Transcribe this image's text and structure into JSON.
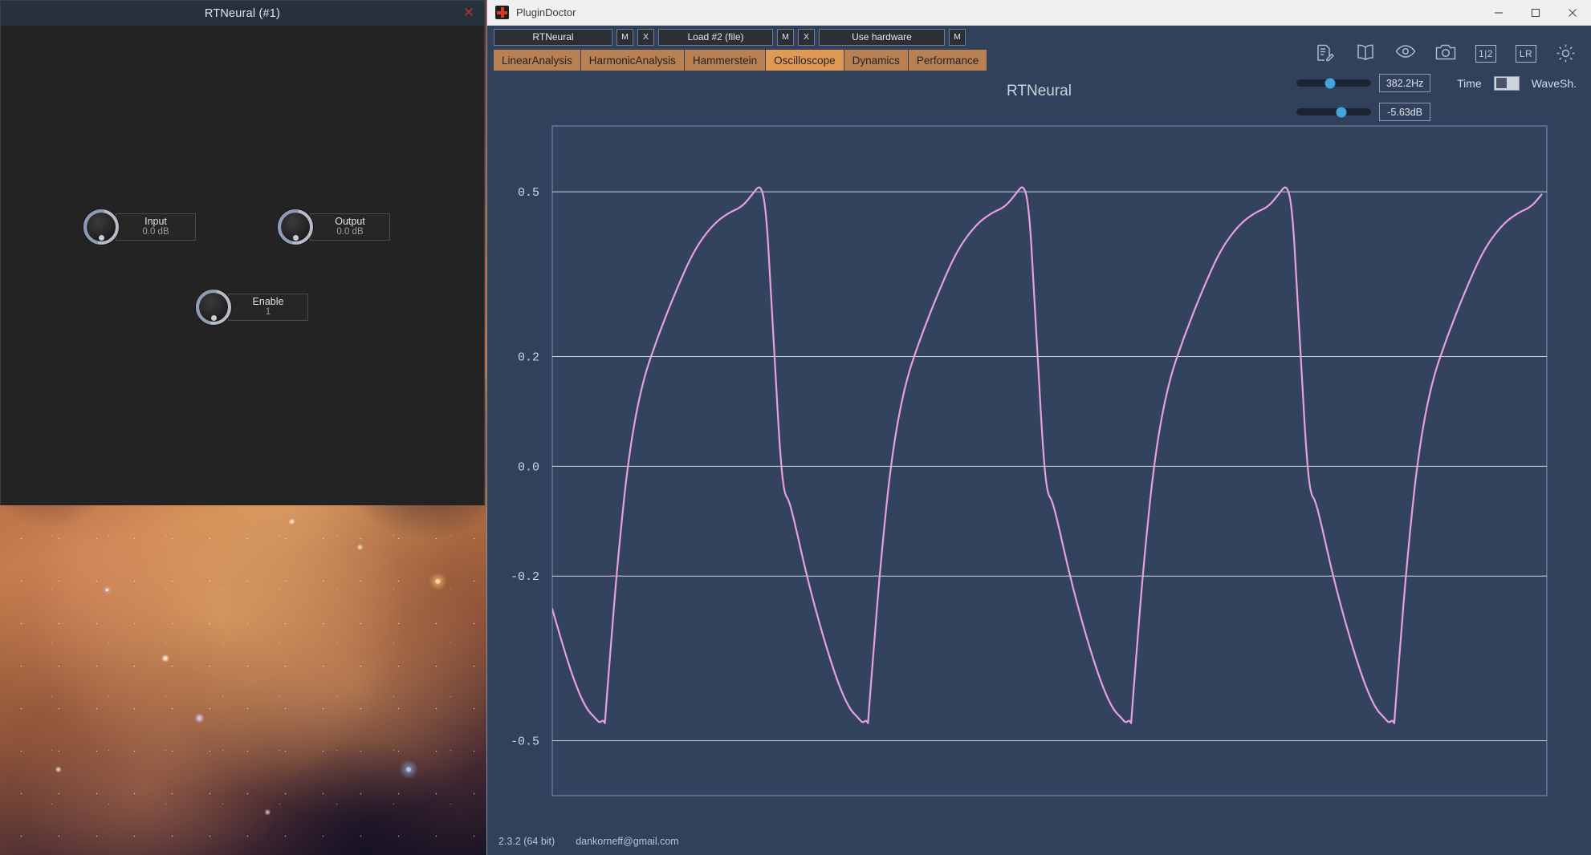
{
  "plugin_window": {
    "title": "RTNeural (#1)",
    "close_icon": "close-icon",
    "knobs": [
      {
        "name": "Input",
        "value": "0.0 dB"
      },
      {
        "name": "Output",
        "value": "0.0 dB"
      },
      {
        "name": "Enable",
        "value": "1"
      }
    ]
  },
  "pd_window": {
    "title": "PluginDoctor",
    "app_icon": "plugindoctor-cross-icon",
    "window_buttons": {
      "minimize": "—",
      "maximize": "☐",
      "close": "✕"
    },
    "slots": [
      {
        "label": "RTNeural",
        "mute": "M",
        "remove": "X"
      },
      {
        "label": "Load #2 (file)",
        "mute": "M",
        "remove": "X"
      },
      {
        "label": "Use hardware",
        "mute": "M",
        "remove": null
      }
    ],
    "tabs": [
      {
        "label": "LinearAnalysis",
        "active": false
      },
      {
        "label": "HarmonicAnalysis",
        "active": false
      },
      {
        "label": "Hammerstein",
        "active": false
      },
      {
        "label": "Oscilloscope",
        "active": true
      },
      {
        "label": "Dynamics",
        "active": false
      },
      {
        "label": "Performance",
        "active": false
      }
    ],
    "toolbar_icons": [
      {
        "name": "notes-edit-icon",
        "label": ""
      },
      {
        "name": "manual-book-icon",
        "label": ""
      },
      {
        "name": "eye-icon",
        "label": ""
      },
      {
        "name": "camera-icon",
        "label": ""
      },
      {
        "name": "ab-compare-icon",
        "label": "1|2"
      },
      {
        "name": "left-right-channel-icon",
        "label": "LR"
      },
      {
        "name": "gear-icon",
        "label": ""
      }
    ],
    "controls": {
      "frequency_value": "382.2Hz",
      "level_value": "-5.63dB",
      "freq_slider_pct": 45,
      "level_slider_pct": 60,
      "mode_left_label": "Time",
      "mode_right_label": "WaveSh.",
      "mode_toggle_state": "left"
    },
    "status_bar": {
      "version": "2.3.2 (64 bit)",
      "contact": "dankorneff@gmail.com"
    },
    "colors": {
      "accent_tab": "#e09a56",
      "tab": "#b98052",
      "background": "#31415c",
      "plot_background": "#33435e",
      "waveform": "#e79fe0",
      "slider_knob": "#42a5dd"
    }
  },
  "chart_data": {
    "type": "line",
    "title": "RTNeural",
    "xlabel": "",
    "ylabel": "",
    "grid": true,
    "legend": "none",
    "ylim": [
      -0.6,
      0.62
    ],
    "yticks": [
      0.5,
      0.2,
      0.0,
      -0.2,
      -0.5
    ],
    "ytick_labels": [
      "0.5",
      "0.2",
      "0.0",
      "-0.2",
      "-0.5"
    ],
    "xlim": [
      0,
      1
    ],
    "xticks": [],
    "cycles": 3.78,
    "peak_value": 0.515,
    "trough_value": -0.468,
    "series": [
      {
        "name": "RTNeural output waveform",
        "color": "#e79fe0",
        "description": "Asymmetric distorted sawtooth; sharp peak just above 0.5 then fast fall with a shelf near -0.05, slow descent to -0.47 then near-vertical rise.",
        "cycle_points": [
          [
            0.0,
            -0.468
          ],
          [
            0.02,
            -0.34
          ],
          [
            0.05,
            -0.165
          ],
          [
            0.09,
            0.02
          ],
          [
            0.14,
            0.15
          ],
          [
            0.2,
            0.235
          ],
          [
            0.27,
            0.32
          ],
          [
            0.34,
            0.395
          ],
          [
            0.41,
            0.44
          ],
          [
            0.47,
            0.462
          ],
          [
            0.52,
            0.472
          ],
          [
            0.56,
            0.495
          ],
          [
            0.592,
            0.515
          ],
          [
            0.612,
            0.47
          ],
          [
            0.63,
            0.33
          ],
          [
            0.65,
            0.15
          ],
          [
            0.668,
            0.01
          ],
          [
            0.682,
            -0.05
          ],
          [
            0.7,
            -0.062
          ],
          [
            0.725,
            -0.11
          ],
          [
            0.76,
            -0.185
          ],
          [
            0.8,
            -0.26
          ],
          [
            0.845,
            -0.335
          ],
          [
            0.89,
            -0.4
          ],
          [
            0.93,
            -0.442
          ],
          [
            0.962,
            -0.458
          ],
          [
            0.98,
            -0.468
          ],
          [
            0.992,
            -0.462
          ],
          [
            1.0,
            -0.468
          ]
        ]
      }
    ]
  }
}
